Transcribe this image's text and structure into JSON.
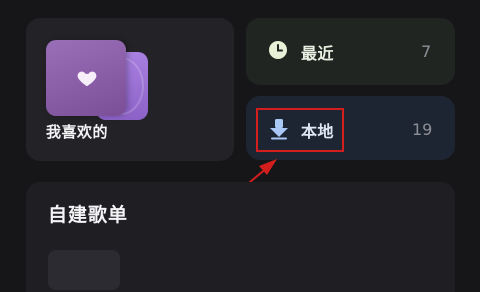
{
  "favorites": {
    "label": "我喜欢的"
  },
  "recent": {
    "label": "最近",
    "count": "7"
  },
  "local": {
    "label": "本地",
    "count": "19"
  },
  "playlists": {
    "title": "自建歌单"
  },
  "colors": {
    "highlight": "#d41e1e",
    "recent_icon": "#e8f0d8",
    "local_icon": "#a9c8f5",
    "favorites_cover": "#8a5fa8"
  },
  "icons": {
    "favorites": "heart-icon",
    "recent": "clock-icon",
    "local": "download-icon"
  }
}
